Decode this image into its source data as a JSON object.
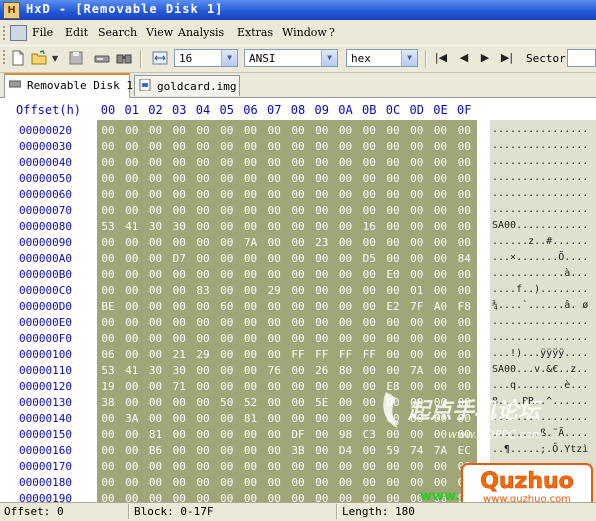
{
  "window": {
    "title": "HxD - [Removable Disk 1]",
    "app_icon_letter": "H"
  },
  "menu": [
    "File",
    "Edit",
    "Search",
    "View",
    "Analysis",
    "Extras",
    "Window",
    "?"
  ],
  "toolbar": {
    "bytes_per_row": "16",
    "charset": "ANSI",
    "offset_base": "hex",
    "sector_label": "Sector",
    "icons": [
      "new-file-icon",
      "open-folder-icon",
      "dropdown-arrow-icon",
      "save-icon",
      "disk-icon",
      "search-icon",
      "column-width-icon"
    ]
  },
  "tabs": [
    {
      "label": "Removable Disk 1",
      "active": true,
      "icon": "disk-icon"
    },
    {
      "label": "goldcard.img",
      "active": false,
      "icon": "file-icon"
    }
  ],
  "hex_header": {
    "offset_label": "Offset(h)",
    "columns": [
      "00",
      "01",
      "02",
      "03",
      "04",
      "05",
      "06",
      "07",
      "08",
      "09",
      "0A",
      "0B",
      "0C",
      "0D",
      "0E",
      "0F"
    ]
  },
  "rows": [
    {
      "offset": "00000020",
      "bytes": [
        "00",
        "00",
        "00",
        "00",
        "00",
        "00",
        "00",
        "00",
        "00",
        "00",
        "00",
        "00",
        "00",
        "00",
        "00",
        "00"
      ],
      "ascii": "................"
    },
    {
      "offset": "00000030",
      "bytes": [
        "00",
        "00",
        "00",
        "00",
        "00",
        "00",
        "00",
        "00",
        "00",
        "00",
        "00",
        "00",
        "00",
        "00",
        "00",
        "00"
      ],
      "ascii": "................"
    },
    {
      "offset": "00000040",
      "bytes": [
        "00",
        "00",
        "00",
        "00",
        "00",
        "00",
        "00",
        "00",
        "00",
        "00",
        "00",
        "00",
        "00",
        "00",
        "00",
        "00"
      ],
      "ascii": "................"
    },
    {
      "offset": "00000050",
      "bytes": [
        "00",
        "00",
        "00",
        "00",
        "00",
        "00",
        "00",
        "00",
        "00",
        "00",
        "00",
        "00",
        "00",
        "00",
        "00",
        "00"
      ],
      "ascii": "................"
    },
    {
      "offset": "00000060",
      "bytes": [
        "00",
        "00",
        "00",
        "00",
        "00",
        "00",
        "00",
        "00",
        "00",
        "00",
        "00",
        "00",
        "00",
        "00",
        "00",
        "00"
      ],
      "ascii": "................"
    },
    {
      "offset": "00000070",
      "bytes": [
        "00",
        "00",
        "00",
        "00",
        "00",
        "00",
        "00",
        "00",
        "00",
        "00",
        "00",
        "00",
        "00",
        "00",
        "00",
        "00"
      ],
      "ascii": "................"
    },
    {
      "offset": "00000080",
      "bytes": [
        "53",
        "41",
        "30",
        "30",
        "00",
        "00",
        "00",
        "00",
        "00",
        "00",
        "00",
        "16",
        "00",
        "00",
        "00",
        "00"
      ],
      "ascii": "SA00............"
    },
    {
      "offset": "00000090",
      "bytes": [
        "00",
        "00",
        "00",
        "00",
        "00",
        "00",
        "7A",
        "00",
        "00",
        "23",
        "00",
        "00",
        "00",
        "00",
        "00",
        "00"
      ],
      "ascii": "......z..#......"
    },
    {
      "offset": "000000A0",
      "bytes": [
        "00",
        "00",
        "00",
        "D7",
        "00",
        "00",
        "00",
        "00",
        "00",
        "00",
        "00",
        "D5",
        "00",
        "00",
        "00",
        "84"
      ],
      "ascii": "...×.......Õ...."
    },
    {
      "offset": "000000B0",
      "bytes": [
        "00",
        "00",
        "00",
        "00",
        "00",
        "00",
        "00",
        "00",
        "00",
        "00",
        "00",
        "00",
        "E0",
        "00",
        "00",
        "00"
      ],
      "ascii": "............à..."
    },
    {
      "offset": "000000C0",
      "bytes": [
        "00",
        "00",
        "00",
        "00",
        "83",
        "00",
        "00",
        "29",
        "00",
        "00",
        "00",
        "00",
        "00",
        "01",
        "00",
        "00"
      ],
      "ascii": "....f..)........"
    },
    {
      "offset": "000000D0",
      "bytes": [
        "BE",
        "00",
        "00",
        "00",
        "00",
        "60",
        "00",
        "00",
        "00",
        "00",
        "00",
        "00",
        "E2",
        "7F",
        "A0",
        "F8"
      ],
      "ascii": "¾....`......â. ø"
    },
    {
      "offset": "000000E0",
      "bytes": [
        "00",
        "00",
        "00",
        "00",
        "00",
        "00",
        "00",
        "00",
        "00",
        "00",
        "00",
        "00",
        "00",
        "00",
        "00",
        "00"
      ],
      "ascii": "................"
    },
    {
      "offset": "000000F0",
      "bytes": [
        "00",
        "00",
        "00",
        "00",
        "00",
        "00",
        "00",
        "00",
        "00",
        "00",
        "00",
        "00",
        "00",
        "00",
        "00",
        "00"
      ],
      "ascii": "................"
    },
    {
      "offset": "00000100",
      "bytes": [
        "06",
        "00",
        "00",
        "21",
        "29",
        "00",
        "00",
        "00",
        "FF",
        "FF",
        "FF",
        "FF",
        "00",
        "00",
        "00",
        "00"
      ],
      "ascii": "...!)...ÿÿÿÿ...."
    },
    {
      "offset": "00000110",
      "bytes": [
        "53",
        "41",
        "30",
        "30",
        "00",
        "00",
        "00",
        "76",
        "00",
        "26",
        "80",
        "00",
        "00",
        "7A",
        "00",
        "00"
      ],
      "ascii": "SA00...v.&€..z.."
    },
    {
      "offset": "00000120",
      "bytes": [
        "19",
        "00",
        "00",
        "71",
        "00",
        "00",
        "00",
        "00",
        "00",
        "00",
        "00",
        "00",
        "E8",
        "00",
        "00",
        "00"
      ],
      "ascii": "...q........è..."
    },
    {
      "offset": "00000130",
      "bytes": [
        "38",
        "00",
        "00",
        "00",
        "00",
        "50",
        "52",
        "00",
        "00",
        "5E",
        "00",
        "00",
        "00",
        "00",
        "00",
        "00"
      ],
      "ascii": "8....PR..^......"
    },
    {
      "offset": "00000140",
      "bytes": [
        "00",
        "3A",
        "00",
        "00",
        "00",
        "00",
        "81",
        "00",
        "00",
        "00",
        "00",
        "00",
        "00",
        "00",
        "00",
        "00"
      ],
      "ascii": ".:.............."
    },
    {
      "offset": "00000150",
      "bytes": [
        "00",
        "00",
        "81",
        "00",
        "00",
        "00",
        "00",
        "00",
        "DF",
        "00",
        "98",
        "C3",
        "00",
        "00",
        "00",
        "00"
      ],
      "ascii": "........ß.˜Ã...."
    },
    {
      "offset": "00000160",
      "bytes": [
        "00",
        "00",
        "B6",
        "00",
        "00",
        "00",
        "00",
        "00",
        "3B",
        "00",
        "D4",
        "00",
        "59",
        "74",
        "7A",
        "EC"
      ],
      "ascii": "..¶.....;.Ô.Ytzì"
    },
    {
      "offset": "00000170",
      "bytes": [
        "00",
        "00",
        "00",
        "00",
        "00",
        "00",
        "00",
        "00",
        "00",
        "00",
        "00",
        "00",
        "00",
        "00",
        "00",
        "00"
      ],
      "ascii": "................"
    },
    {
      "offset": "00000180",
      "bytes": [
        "00",
        "00",
        "00",
        "00",
        "00",
        "00",
        "00",
        "00",
        "00",
        "00",
        "00",
        "00",
        "00",
        "00",
        "00",
        "00"
      ],
      "ascii": "................"
    },
    {
      "offset": "00000190",
      "bytes": [
        "00",
        "00",
        "00",
        "00",
        "00",
        "00",
        "00",
        "00",
        "00",
        "00",
        "00",
        "00",
        "00",
        "00",
        "00",
        "00"
      ],
      "ascii": "................"
    }
  ],
  "watermarks": {
    "qdppc_name": "起点手机论坛",
    "qdppc_url": "www.QDPPC.com",
    "quzhuo_name": "Quzhuo",
    "quzhuo_url": "www.quzhuo.com",
    "www_partial": "www."
  },
  "status": {
    "offset": "Offset: 0",
    "block": "Block: 0-17F",
    "length": "Length: 180"
  },
  "colors": {
    "selection": "#9fa677",
    "ascii_bg": "#dfe1ce",
    "offset_text": "#0a0ab0",
    "tab_accent": "#e68b2c"
  }
}
